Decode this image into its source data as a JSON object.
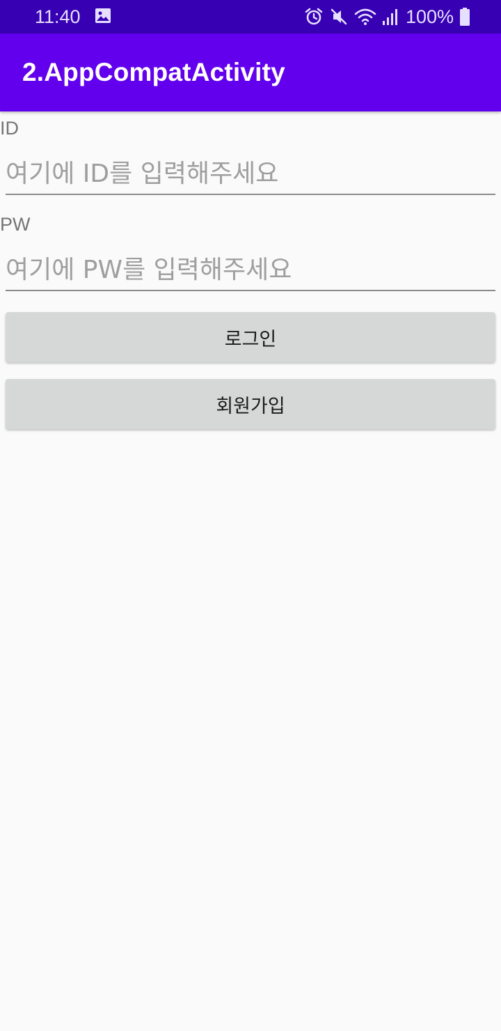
{
  "status_bar": {
    "time": "11:40",
    "left_icons": [
      "image-icon"
    ],
    "right_icons": [
      "alarm-icon",
      "mute-icon",
      "wifi-icon",
      "signal-icon",
      "battery-icon"
    ],
    "battery": "100%",
    "color": "#3700b3"
  },
  "app_bar": {
    "title": "2.AppCompatActivity",
    "color": "#6200ee"
  },
  "form": {
    "id_label": "ID",
    "id_value": "",
    "id_placeholder": "여기에 ID를 입력해주세요",
    "pw_label": "PW",
    "pw_value": "",
    "pw_placeholder": "여기에 PW를 입력해주세요"
  },
  "buttons": {
    "login_label": "로그인",
    "signup_label": "회원가입"
  }
}
